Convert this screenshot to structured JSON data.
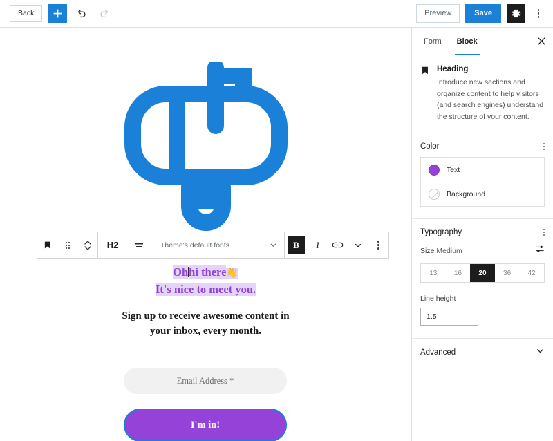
{
  "topbar": {
    "back_label": "Back",
    "add_icon": "plus-icon",
    "undo_icon": "undo-arrow-icon",
    "redo_icon": "redo-arrow-icon",
    "preview_label": "Preview",
    "save_label": "Save",
    "settings_icon": "gear-icon",
    "more_icon": "kebab-menu-icon",
    "accent_color": "#1a80d8"
  },
  "canvas": {
    "illustration_icon": "mailbox-icon",
    "illustration_color": "#1a80d8",
    "block_toolbar": {
      "block_type_icon": "heading-block-icon",
      "drag_icon": "drag-handle-icon",
      "move_icon": "move-up-down-icon",
      "heading_level": "H2",
      "align_icon": "text-align-icon",
      "font_value": "Theme's default fonts",
      "font_chevron_icon": "chevron-down-icon",
      "bold_label": "B",
      "bold_active": true,
      "italic_label": "I",
      "link_icon": "link-icon",
      "more_formats_icon": "chevron-down-icon",
      "options_icon": "kebab-menu-icon"
    },
    "heading": {
      "line1_part1": "Oh",
      "line1_part2": "hi there",
      "line1_emoji": "👋",
      "line2": "It's nice to meet you.",
      "color": "#8e44d8",
      "selection_color": "#e4d4f7"
    },
    "paragraph": {
      "line1": "Sign up to receive awesome content in",
      "line2": "your inbox, every month."
    },
    "email_input": {
      "placeholder": "Email Address *"
    },
    "submit_button": {
      "label": "I'm in!",
      "bg_color": "#9442d8",
      "outline_color": "#1a80d8"
    }
  },
  "sidebar": {
    "tabs": [
      {
        "label": "Form",
        "active": false
      },
      {
        "label": "Block",
        "active": true
      }
    ],
    "close_icon": "close-icon",
    "block_info": {
      "icon": "heading-block-icon",
      "title": "Heading",
      "description": "Introduce new sections and organize content to help visitors (and search engines) understand the structure of your content."
    },
    "color": {
      "title": "Color",
      "options_icon": "kebab-menu-icon",
      "rows": [
        {
          "label": "Text",
          "swatch": "#9442d8",
          "has_color": true
        },
        {
          "label": "Background",
          "swatch": "none",
          "has_color": false
        }
      ]
    },
    "typography": {
      "title": "Typography",
      "options_icon": "kebab-menu-icon",
      "size_label": "Size",
      "size_value": "Medium",
      "size_settings_icon": "sliders-icon",
      "sizes": [
        "13",
        "16",
        "20",
        "36",
        "42"
      ],
      "size_selected": "20",
      "line_height_label": "Line height",
      "line_height_value": "1.5"
    },
    "advanced": {
      "title": "Advanced",
      "chevron_icon": "chevron-down-icon"
    }
  }
}
